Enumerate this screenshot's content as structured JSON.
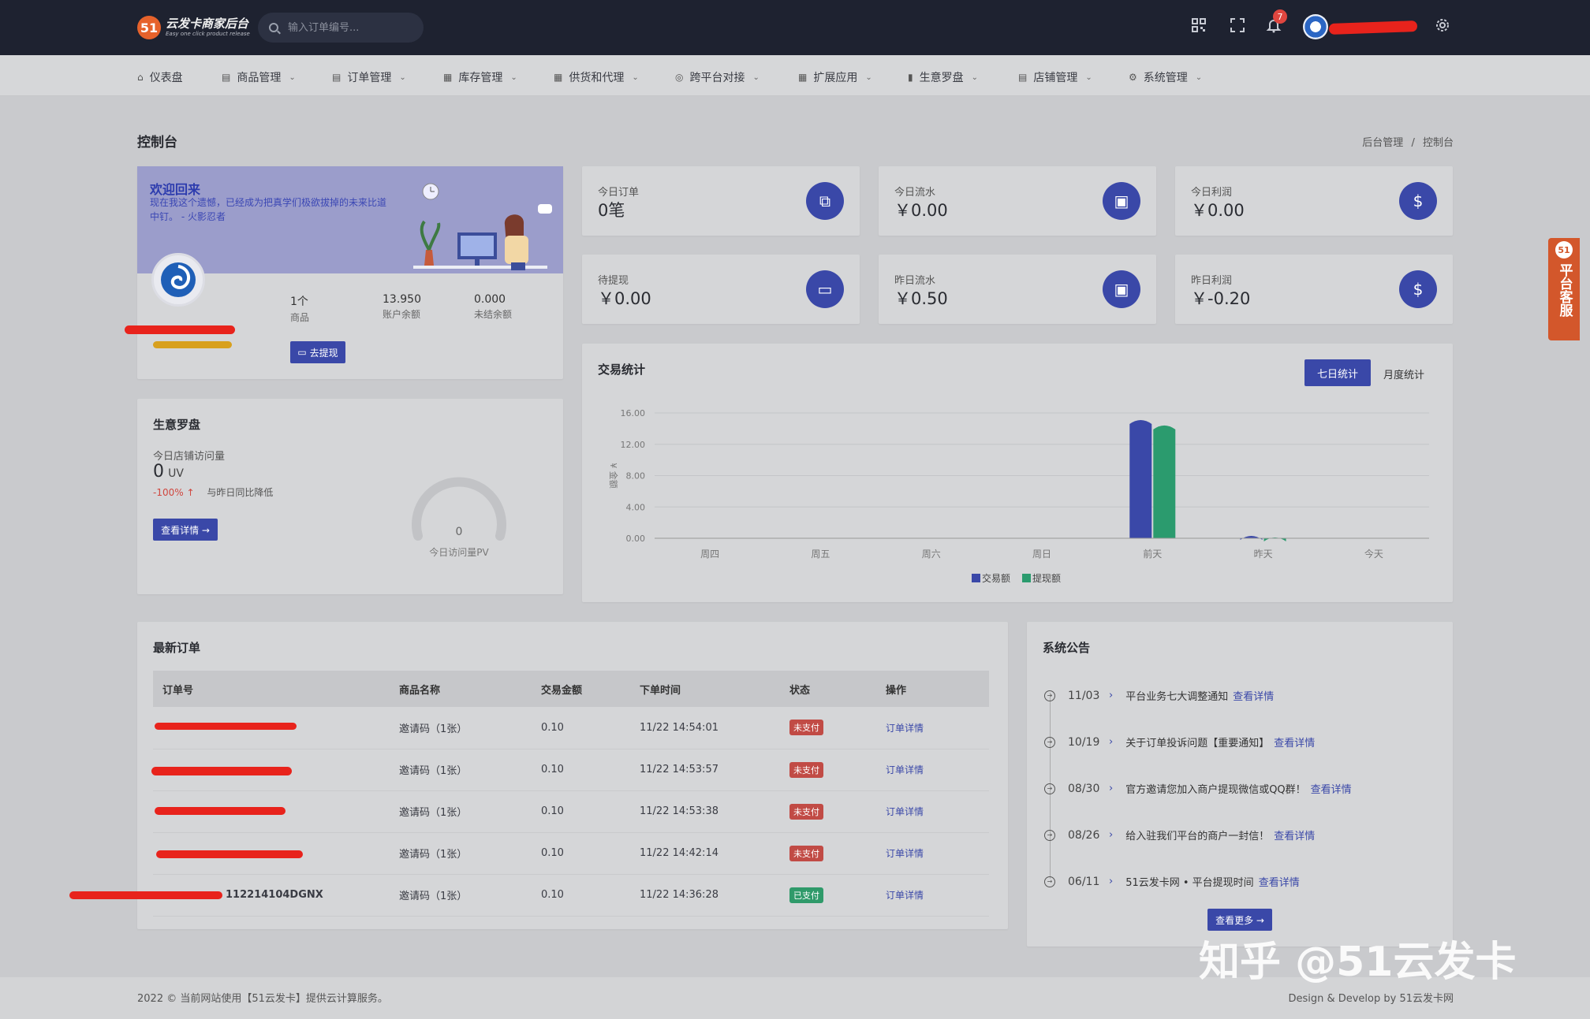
{
  "header": {
    "logo_mark": "51",
    "logo_title": "云发卡商家后台",
    "logo_subtitle": "Easy one click product release",
    "search_placeholder": "输入订单编号...",
    "notification_count": "7"
  },
  "nav": {
    "items": [
      {
        "label": "仪表盘"
      },
      {
        "label": "商品管理"
      },
      {
        "label": "订单管理"
      },
      {
        "label": "库存管理"
      },
      {
        "label": "供货和代理"
      },
      {
        "label": "跨平台对接"
      },
      {
        "label": "扩展应用"
      },
      {
        "label": "生意罗盘"
      },
      {
        "label": "店铺管理"
      },
      {
        "label": "系统管理"
      }
    ]
  },
  "page": {
    "title": "控制台",
    "breadcrumb": [
      "后台管理",
      "/",
      "控制台"
    ]
  },
  "welcome": {
    "title": "欢迎回来",
    "text": "现在我这个遗憾，已经成为把真学们极欲拔掉的未来比道中钉。 - 火影忍者",
    "stats": [
      {
        "value": "1个",
        "label": "商品"
      },
      {
        "value": "13.950",
        "label": "账户余额"
      },
      {
        "value": "0.000",
        "label": "未结余额"
      }
    ],
    "withdraw_label": "去提现"
  },
  "stats": [
    {
      "label": "今日订单",
      "value": "0笔",
      "icon": "copy-icon"
    },
    {
      "label": "今日流水",
      "value": "￥0.00",
      "icon": "archive-icon"
    },
    {
      "label": "今日利润",
      "value": "￥0.00",
      "icon": "dollar-icon"
    },
    {
      "label": "待提现",
      "value": "￥0.00",
      "icon": "card-icon"
    },
    {
      "label": "昨日流水",
      "value": "￥0.50",
      "icon": "archive-icon"
    },
    {
      "label": "昨日利润",
      "value": "￥-0.20",
      "icon": "dollar-icon"
    }
  ],
  "compass": {
    "title": "生意罗盘",
    "visits_label": "今日店铺访问量",
    "visits_value": "0",
    "visits_unit": "UV",
    "change": "-100% ↑",
    "change_text": "与昨日同比降低",
    "detail_button": "查看详情 →",
    "gauge_value": "0",
    "gauge_label": "今日访问量PV"
  },
  "trade": {
    "title": "交易统计",
    "tab_week": "七日统计",
    "tab_month": "月度统计"
  },
  "chart_data": {
    "type": "bar",
    "categories": [
      "周四",
      "周五",
      "周六",
      "周日",
      "前天",
      "昨天",
      "今天"
    ],
    "series": [
      {
        "name": "交易额",
        "values": [
          0,
          0,
          0,
          0,
          15.2,
          0.4,
          0
        ],
        "color": "#3a48a8"
      },
      {
        "name": "提现额",
        "values": [
          0,
          0,
          0,
          0,
          14.5,
          0.2,
          0
        ],
        "color": "#2b9b6e"
      }
    ],
    "ylabel": "¥ 金额",
    "yticks": [
      "0.00",
      "4.00",
      "8.00",
      "12.00",
      "16.00"
    ],
    "ylim": [
      0,
      16
    ],
    "grid": true,
    "legend": "bottom"
  },
  "orders": {
    "title": "最新订单",
    "columns": [
      "订单号",
      "商品名称",
      "交易金额",
      "下单时间",
      "状态",
      "操作"
    ],
    "rows": [
      {
        "id": "",
        "product": "邀请码（1张）",
        "amount": "0.10",
        "time": "11/22 14:54:01",
        "status": "未支付",
        "action": "订单详情"
      },
      {
        "id": "",
        "product": "邀请码（1张）",
        "amount": "0.10",
        "time": "11/22 14:53:57",
        "status": "未支付",
        "action": "订单详情"
      },
      {
        "id": "",
        "product": "邀请码（1张）",
        "amount": "0.10",
        "time": "11/22 14:53:38",
        "status": "未支付",
        "action": "订单详情"
      },
      {
        "id": "",
        "product": "邀请码（1张）",
        "amount": "0.10",
        "time": "11/22 14:42:14",
        "status": "未支付",
        "action": "订单详情"
      },
      {
        "id": "112214104DGNX",
        "product": "邀请码（1张）",
        "amount": "0.10",
        "time": "11/22 14:36:28",
        "status": "已支付",
        "action": "订单详情"
      }
    ]
  },
  "notices": {
    "title": "系统公告",
    "items": [
      {
        "date": "11/03",
        "text": "平台业务七大调整通知",
        "link": "查看详情"
      },
      {
        "date": "10/19",
        "text": "关于订单投诉问题【重要通知】",
        "link": "查看详情"
      },
      {
        "date": "08/30",
        "text": "官方邀请您加入商户提现微信或QQ群！",
        "link": "查看详情"
      },
      {
        "date": "08/26",
        "text": "给入驻我们平台的商户一封信！",
        "link": "查看详情"
      },
      {
        "date": "06/11",
        "text": "51云发卡网 • 平台提现时间",
        "link": "查看详情"
      }
    ],
    "more_button": "查看更多 →"
  },
  "footer": {
    "left": "2022 © 当前网站使用【51云发卡】提供云计算服务。",
    "right": "Design & Develop by 51云发卡网"
  },
  "service": {
    "mark": "51",
    "label": "平台客服"
  },
  "watermark": "知乎 @51云发卡",
  "colors": {
    "topbar": "#1e2230",
    "accent": "#3a48a8",
    "green": "#2b9b6e",
    "unpaid": "#c14b45",
    "service": "#d3572b"
  }
}
